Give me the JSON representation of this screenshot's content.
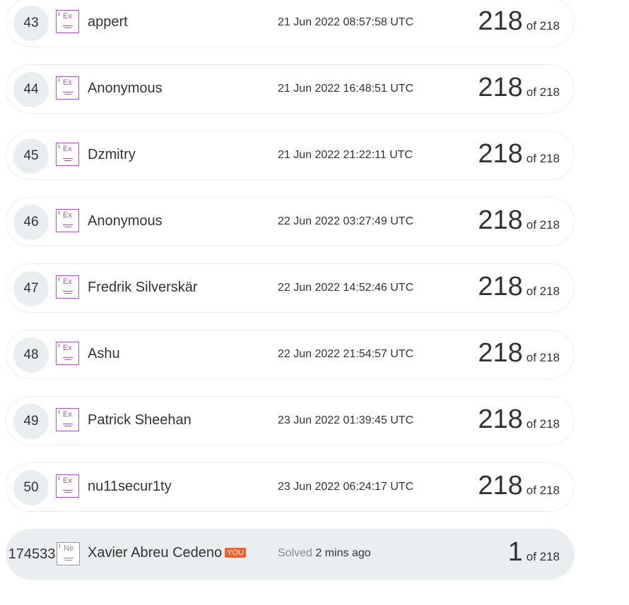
{
  "badge_color": "#a45ab5",
  "you_tag_color": "#f05f29",
  "rows": [
    {
      "rank": "43",
      "badge": "Ex",
      "name": "appert",
      "time": "21 Jun 2022 08:57:58 UTC",
      "score": "218",
      "of": "of 218"
    },
    {
      "rank": "44",
      "badge": "Ex",
      "name": "Anonymous",
      "time": "21 Jun 2022 16:48:51 UTC",
      "score": "218",
      "of": "of 218"
    },
    {
      "rank": "45",
      "badge": "Ex",
      "name": "Dzmitry",
      "time": "21 Jun 2022 21:22:11 UTC",
      "score": "218",
      "of": "of 218"
    },
    {
      "rank": "46",
      "badge": "Ex",
      "name": "Anonymous",
      "time": "22 Jun 2022 03:27:49 UTC",
      "score": "218",
      "of": "of 218"
    },
    {
      "rank": "47",
      "badge": "Ex",
      "name": "Fredrik Silverskär",
      "time": "22 Jun 2022 14:52:46 UTC",
      "score": "218",
      "of": "of 218"
    },
    {
      "rank": "48",
      "badge": "Ex",
      "name": "Ashu",
      "time": "22 Jun 2022 21:54:57 UTC",
      "score": "218",
      "of": "of 218"
    },
    {
      "rank": "49",
      "badge": "Ex",
      "name": "Patrick Sheehan",
      "time": "23 Jun 2022 01:39:45 UTC",
      "score": "218",
      "of": "of 218"
    },
    {
      "rank": "50",
      "badge": "Ex",
      "name": "nu11secur1ty",
      "time": "23 Jun 2022 06:24:17 UTC",
      "score": "218",
      "of": "of 218"
    }
  ],
  "you_row": {
    "rank": "174533",
    "badge": "Ne",
    "name": "Xavier Abreu Cedeno",
    "tag": "YOU",
    "solved_label": "Solved",
    "solved_time": "2 mins ago",
    "score": "1",
    "of": "of 218"
  }
}
